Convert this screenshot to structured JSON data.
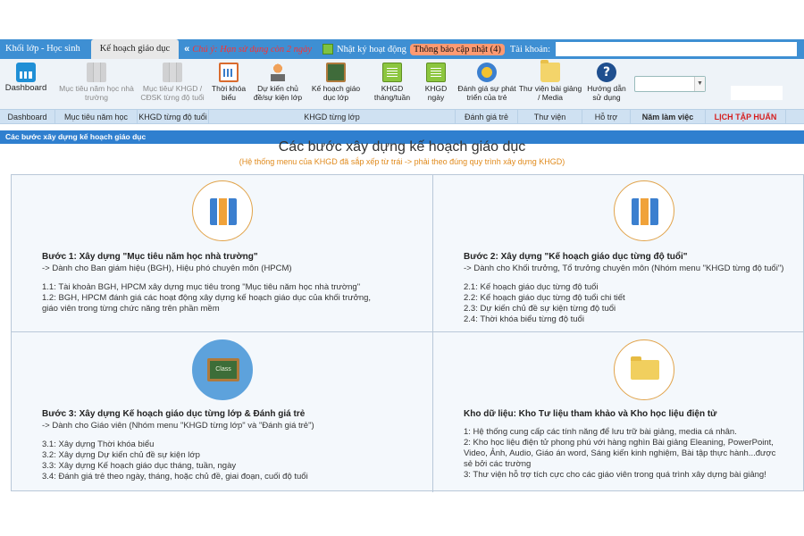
{
  "topbar": {
    "tab_students": "Khối lớp - Học sinh",
    "tab_plan": "Kế hoạch giáo dục",
    "arrow": "«",
    "warning": "Chú ý: Hạn sử dụng còn 2 ngày",
    "diary": "Nhật ký hoạt động",
    "notice": "Thông báo cập nhật (4)",
    "account_label": "Tài khoản:"
  },
  "toolbar": {
    "items": [
      {
        "label": "Dashboard",
        "icon": "dashboard-icon"
      },
      {
        "label": "Mục tiêu năm học nhà trường",
        "icon": "binder-icon"
      },
      {
        "label": "Mục tiêu/ KHGD / CĐSK từng độ tuổi",
        "icon": "binder-icon"
      },
      {
        "label": "Thời khóa biểu",
        "icon": "calendar-icon"
      },
      {
        "label": "Dự kiến chủ đề/sự kiện lớp",
        "icon": "teacher-icon"
      },
      {
        "label": "Kế hoạch giáo dục lớp",
        "icon": "blackboard-icon"
      },
      {
        "label": "KHGD tháng/tuần",
        "icon": "book-icon"
      },
      {
        "label": "KHGD ngày",
        "icon": "book-icon"
      },
      {
        "label": "Đánh giá sự phát triển của trẻ",
        "icon": "badge-icon"
      },
      {
        "label": "Thư viện bài giảng / Media",
        "icon": "folder-icon"
      },
      {
        "label": "Hướng dẫn sử dụng",
        "icon": "help-icon"
      }
    ]
  },
  "categories": {
    "dashboard": "Dashboard",
    "goals": "Mục tiêu năm học",
    "age": "KHGD từng độ tuổi",
    "class": "KHGD từng lớp",
    "eval": "Đánh giá trẻ",
    "library": "Thư viện",
    "support": "Hỗ trợ",
    "year": "Năm làm việc",
    "training": "LỊCH TẬP HUẤN"
  },
  "strip": "Các bước xây dựng kế hoạch giáo dục",
  "main": {
    "title": "Các bước xây dựng kế hoạch giáo dục",
    "subtitle": "(Hệ thống menu của KHGD đã sắp xếp từ trái -> phải theo đúng quy trình xây dựng KHGD)"
  },
  "steps": [
    {
      "heading": "Bước 1: Xây dựng \"Mục tiêu năm học nhà trường\"",
      "audience": "-> Dành cho Ban giám hiệu (BGH), Hiệu phó chuyên môn (HPCM)",
      "lines": [
        "1.1: Tài khoản BGH, HPCM xây dựng mục tiêu trong \"Mục tiêu năm học nhà trường\"",
        "1.2: BGH, HPCM đánh giá các hoạt động xây dựng kế hoạch giáo dục của khối trưởng,",
        "giáo viên trong từng chức năng trên phần mềm"
      ]
    },
    {
      "heading": "Bước 2: Xây dựng \"Kế hoạch giáo dục từng độ tuổi\"",
      "audience": "-> Dành cho Khối trưởng, Tổ trưởng chuyên môn (Nhóm menu \"KHGD từng độ tuổi\")",
      "lines": [
        "2.1: Kế hoạch giáo dục từng độ tuổi",
        "2.2: Kế hoạch giáo dục từng độ tuổi chi tiết",
        "2.3: Dự kiến chủ đề sự kiện từng độ tuổi",
        "2.4: Thời khóa biểu từng độ tuổi"
      ]
    },
    {
      "heading": "Bước 3: Xây dựng Kế hoạch giáo dục từng lớp & Đánh giá trẻ",
      "audience": "-> Dành cho Giáo viên (Nhóm menu \"KHGD từng lớp\" và \"Đánh giá trẻ\")",
      "lines": [
        "3.1: Xây dựng Thời khóa biểu",
        "3.2: Xây dựng Dự kiến chủ đề sự kiện lớp",
        "3.3: Xây dựng Kế hoạch giáo dục tháng, tuần, ngày",
        "3.4: Đánh giá trẻ theo ngày, tháng, hoặc chủ đề, giai đoạn, cuối độ tuổi"
      ]
    },
    {
      "heading": "Kho dữ liệu: Kho Tư liệu tham khảo và Kho học liệu điện tử",
      "audience": "",
      "lines": [
        "1: Hệ thống cung cấp các tính năng để lưu trữ bài giảng, media cá nhân.",
        "2: Kho học liệu điện tử phong phú với hàng nghìn Bài giảng Eleaning, PowerPoint,",
        "Video, Ảnh, Audio, Giáo án word, Sáng kiến kinh nghiệm, Bài tập thực hành...được",
        "sẻ bởi các trường",
        "3: Thư viện hỗ trợ tích cực cho các giáo viên trong quá trình xây dựng bài giảng!"
      ]
    }
  ],
  "blackboard_text": "Class"
}
